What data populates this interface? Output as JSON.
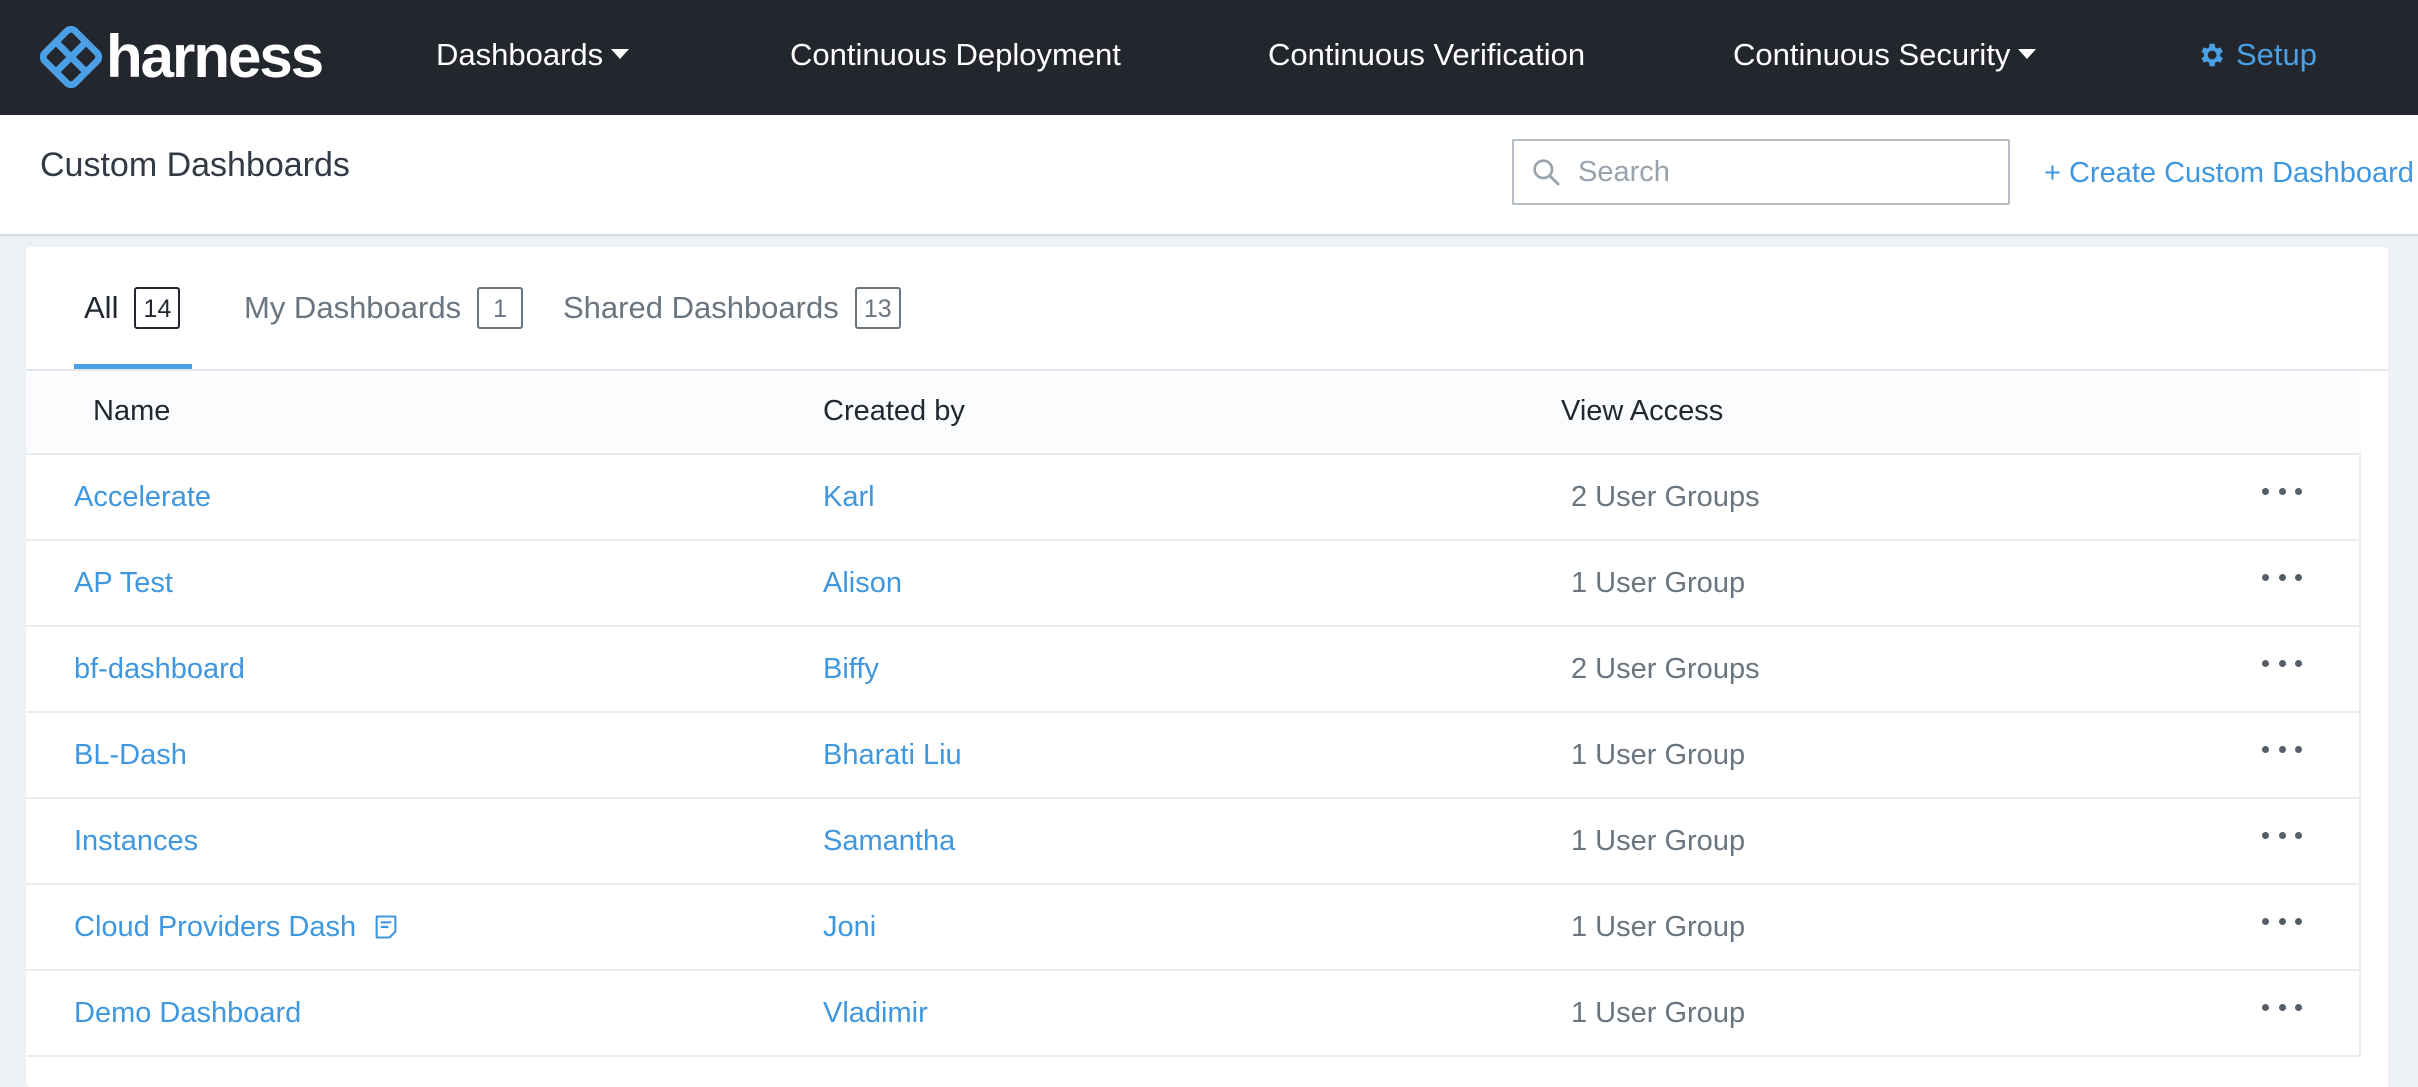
{
  "brand": {
    "name": "harness",
    "color": "#4a9fe5"
  },
  "nav": {
    "dashboards": "Dashboards",
    "continuous_deployment": "Continuous Deployment",
    "continuous_verification": "Continuous Verification",
    "continuous_security": "Continuous Security",
    "setup": "Setup"
  },
  "header": {
    "title": "Custom Dashboards",
    "search_placeholder": "Search",
    "create_label": "+ Create Custom Dashboard"
  },
  "tabs": [
    {
      "label": "All",
      "count": "14",
      "active": true
    },
    {
      "label": "My Dashboards",
      "count": "1",
      "active": false
    },
    {
      "label": "Shared Dashboards",
      "count": "13",
      "active": false
    }
  ],
  "table": {
    "columns": [
      "Name",
      "Created by",
      "View Access"
    ],
    "rows": [
      {
        "name": "Accelerate",
        "created_by": "Karl",
        "view_access": "2 User Groups",
        "has_note": false
      },
      {
        "name": "AP Test",
        "created_by": "Alison",
        "view_access": "1 User Group",
        "has_note": false
      },
      {
        "name": "bf-dashboard",
        "created_by": "Biffy",
        "view_access": "2 User Groups",
        "has_note": false
      },
      {
        "name": "BL-Dash",
        "created_by": "Bharati Liu",
        "view_access": "1 User Group",
        "has_note": false
      },
      {
        "name": "Instances",
        "created_by": "Samantha",
        "view_access": "1 User Group",
        "has_note": false
      },
      {
        "name": "Cloud Providers Dash",
        "created_by": "Joni",
        "view_access": "1 User Group",
        "has_note": true
      },
      {
        "name": "Demo Dashboard",
        "created_by": "Vladimir",
        "view_access": "1 User Group",
        "has_note": false
      }
    ]
  },
  "icons": {
    "logo": "harness-logo-icon",
    "dropdown": "chevron-down-icon",
    "setup": "gear-icon",
    "search": "search-icon",
    "row_menu": "more-horizontal-icon",
    "note": "note-icon"
  }
}
